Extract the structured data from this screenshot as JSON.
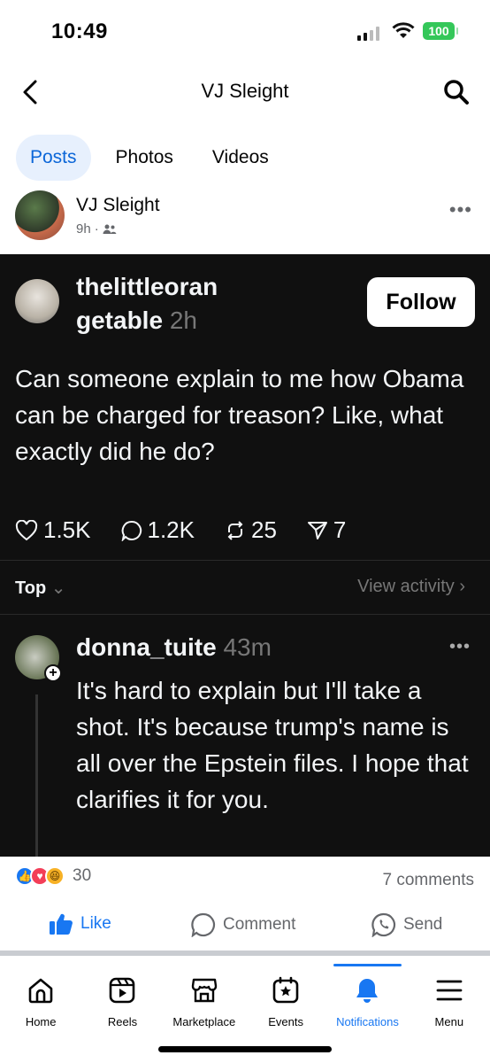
{
  "status": {
    "time": "10:49",
    "battery": "100"
  },
  "header": {
    "title": "VJ Sleight"
  },
  "tabs": [
    {
      "label": "Posts",
      "active": true
    },
    {
      "label": "Photos"
    },
    {
      "label": "Videos"
    }
  ],
  "post": {
    "author": "VJ Sleight",
    "age": "9h",
    "audience_icon": "friends-icon"
  },
  "thread": {
    "username_line1": "thelittleoran",
    "username_line2": "getable",
    "age": "2h",
    "follow_label": "Follow",
    "text": "Can someone explain to me how Obama can be charged for treason? Like, what exactly did he do?",
    "stats": {
      "likes": "1.5K",
      "replies": "1.2K",
      "reposts": "25",
      "shares": "7"
    },
    "sort_label": "Top",
    "view_activity": "View activity",
    "comment": {
      "username": "donna_tuite",
      "age": "43m",
      "text": "It's hard to explain but I'll take a shot. It's because trump's name is all over the Epstein files. I hope that clarifies it for you."
    }
  },
  "reactions": {
    "count": "30",
    "comments": "7 comments"
  },
  "actions": {
    "like": "Like",
    "comment": "Comment",
    "send": "Send"
  },
  "nav": [
    {
      "label": "Home",
      "icon": "home-icon"
    },
    {
      "label": "Reels",
      "icon": "reels-icon"
    },
    {
      "label": "Marketplace",
      "icon": "marketplace-icon"
    },
    {
      "label": "Events",
      "icon": "events-icon"
    },
    {
      "label": "Notifications",
      "icon": "bell-icon",
      "active": true
    },
    {
      "label": "Menu",
      "icon": "menu-icon"
    }
  ],
  "colors": {
    "accent": "#1877f2",
    "dark_bg": "#101010",
    "tab_active_bg": "#e7f0fd"
  }
}
